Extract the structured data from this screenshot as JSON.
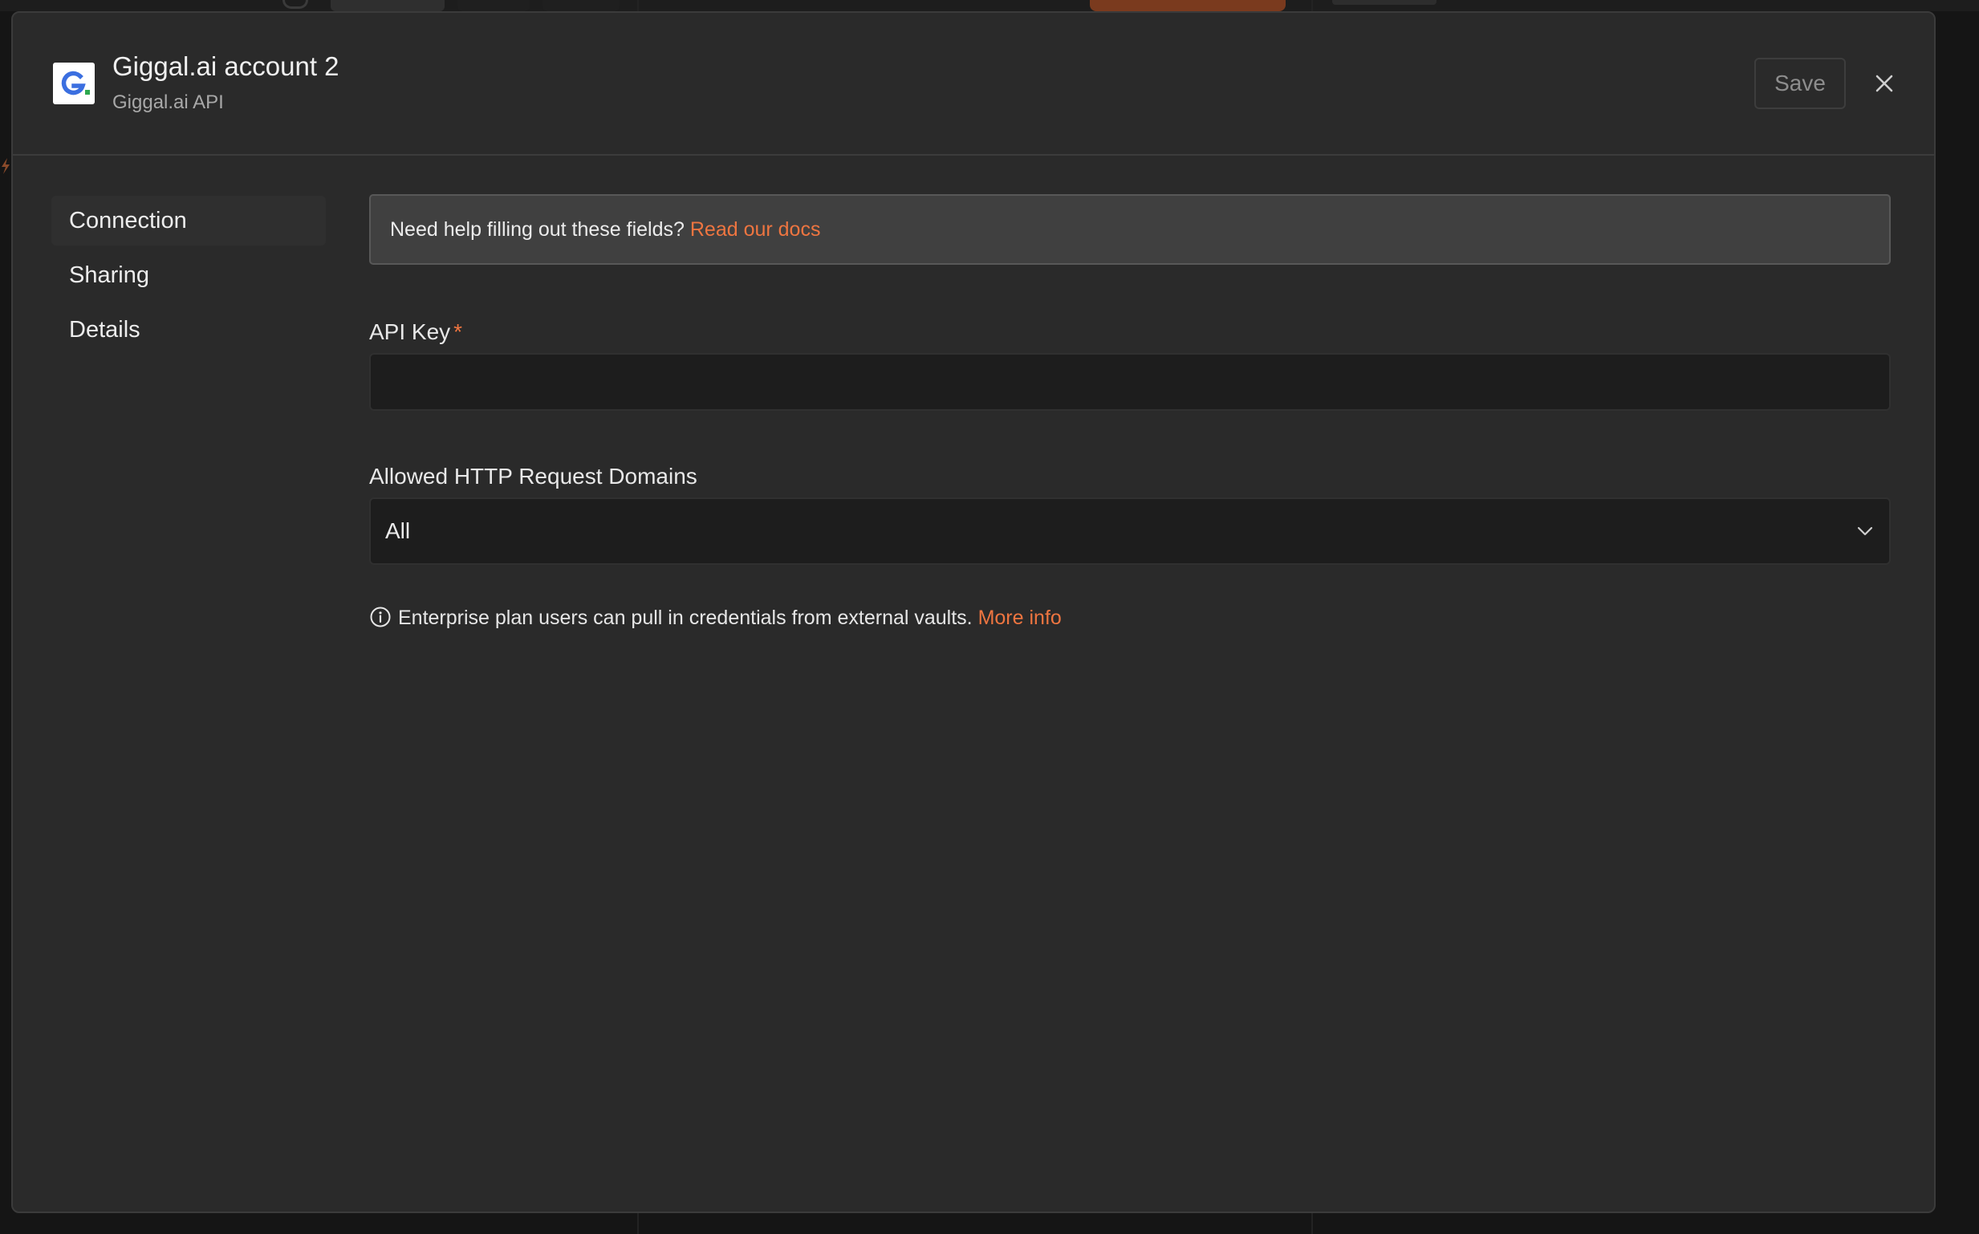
{
  "modal": {
    "title": "Giggal.ai account 2",
    "subtitle": "Giggal.ai API",
    "logo_icon": "giggal-logo-icon",
    "save_label": "Save",
    "close_icon": "close-icon"
  },
  "sidebar": {
    "items": [
      {
        "label": "Connection",
        "active": true
      },
      {
        "label": "Sharing",
        "active": false
      },
      {
        "label": "Details",
        "active": false
      }
    ]
  },
  "help": {
    "text": "Need help filling out these fields? ",
    "link_label": "Read our docs"
  },
  "fields": {
    "api_key": {
      "label": "API Key",
      "required_marker": "*",
      "value": "",
      "placeholder": ""
    },
    "domains": {
      "label": "Allowed HTTP Request Domains",
      "selected": "All",
      "icon": "chevron-down-icon"
    }
  },
  "info": {
    "icon": "info-icon",
    "text": "Enterprise plan users can pull in credentials from external vaults. ",
    "link_label": "More info"
  },
  "colors": {
    "accent": "#ee7540",
    "modal_background": "#2a2a2a",
    "input_background": "#1d1d1d",
    "logo_blue": "#3b6fe0",
    "logo_green": "#2ea84f"
  }
}
